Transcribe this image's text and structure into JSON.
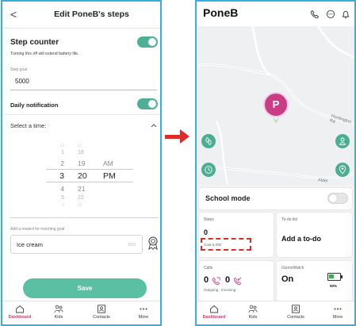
{
  "left_screen": {
    "header": {
      "back_glyph": "<",
      "title": "Edit PoneB's steps"
    },
    "step_counter": {
      "title": "Step counter",
      "note": "Turning this off will extend battery life.",
      "enabled": true
    },
    "step_goal": {
      "label": "Step goal",
      "value": "5000"
    },
    "daily_notification": {
      "title": "Daily notification",
      "enabled": true
    },
    "select_time": {
      "label": "Select a time:",
      "hours": [
        "12",
        "1",
        "2",
        "3",
        "4",
        "5",
        "6"
      ],
      "minutes": [
        "17",
        "18",
        "19",
        "20",
        "21",
        "22",
        "23"
      ],
      "ampm": [
        "AM",
        "PM"
      ],
      "selected": {
        "hour": "3",
        "minute": "20",
        "ampm": "PM"
      }
    },
    "reward": {
      "label": "Add a reward for reaching goal",
      "value": "Ice cream",
      "count": "9/10"
    },
    "save_label": "Save"
  },
  "right_screen": {
    "header": {
      "name": "PoneB"
    },
    "map": {
      "road_label": "Huntington Rd",
      "road_label_2": "Alder",
      "kid_initial": "P"
    },
    "school_mode": {
      "title": "School mode",
      "enabled": false
    },
    "steps_card": {
      "label": "Steps",
      "value": "0",
      "goal": "Goal 5,000"
    },
    "todo_card": {
      "label": "To-do list",
      "action": "Add a to-do"
    },
    "calls_card": {
      "label": "Calls",
      "outgoing_value": "0",
      "outgoing_label": "Outgoing",
      "incoming_value": "0",
      "incoming_label": "Incoming"
    },
    "watch_card": {
      "label": "GizmoWatch",
      "status": "On",
      "battery": "50%",
      "battery_level": 0.5
    }
  },
  "nav": {
    "items": [
      {
        "label": "Dashboard",
        "icon": "home-icon",
        "active": true
      },
      {
        "label": "Kids",
        "icon": "kids-icon"
      },
      {
        "label": "Contacts",
        "icon": "contacts-icon"
      },
      {
        "label": "More",
        "icon": "more-icon"
      }
    ]
  },
  "colors": {
    "accent_green": "#4caf96",
    "save_green": "#5bbfa3",
    "annotation_red": "#e02b2b",
    "frame_blue": "#35aee0",
    "kid_magenta": "#c93c86",
    "nav_active": "#d93a6b"
  }
}
